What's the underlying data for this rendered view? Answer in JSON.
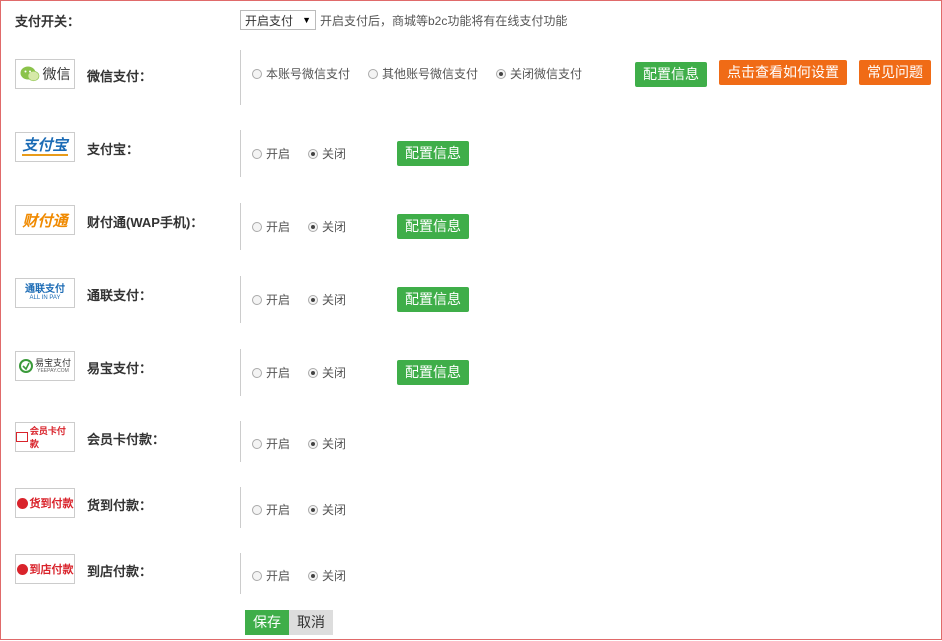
{
  "switch": {
    "label": "支付开关：",
    "selected": "开启支付",
    "hint": "开启支付后，商城等b2c功能将有在线支付功能"
  },
  "payments": [
    {
      "name": "微信支付：",
      "logo_text": "微信",
      "options": [
        "本账号微信支付",
        "其他账号微信支付",
        "关闭微信支付"
      ],
      "selected": 2,
      "buttons": [
        "配置信息",
        "点击查看如何设置",
        "常见问题"
      ]
    },
    {
      "name": "支付宝：",
      "logo_text": "支付宝",
      "options": [
        "开启",
        "关闭"
      ],
      "selected": 1,
      "buttons": [
        "配置信息"
      ]
    },
    {
      "name": "财付通(WAP手机)：",
      "logo_text": "财付通",
      "options": [
        "开启",
        "关闭"
      ],
      "selected": 1,
      "buttons": [
        "配置信息"
      ]
    },
    {
      "name": "通联支付：",
      "logo_text": "通联支付",
      "logo_sub": "ALL IN PAY",
      "options": [
        "开启",
        "关闭"
      ],
      "selected": 1,
      "buttons": [
        "配置信息"
      ]
    },
    {
      "name": "易宝支付：",
      "logo_text": "易宝支付",
      "logo_sub": "YEEPAY.COM",
      "options": [
        "开启",
        "关闭"
      ],
      "selected": 1,
      "buttons": [
        "配置信息"
      ]
    },
    {
      "name": "会员卡付款：",
      "logo_text": "会员卡付款",
      "options": [
        "开启",
        "关闭"
      ],
      "selected": 1,
      "buttons": []
    },
    {
      "name": "货到付款：",
      "logo_text": "货到付款",
      "options": [
        "开启",
        "关闭"
      ],
      "selected": 1,
      "buttons": []
    },
    {
      "name": "到店付款：",
      "logo_text": "到店付款",
      "options": [
        "开启",
        "关闭"
      ],
      "selected": 1,
      "buttons": []
    }
  ],
  "actions": {
    "save": "保存",
    "cancel": "取消"
  },
  "colors": {
    "green": "#3fae49",
    "orange": "#f06b16",
    "border_accent": "#e06a6a"
  }
}
